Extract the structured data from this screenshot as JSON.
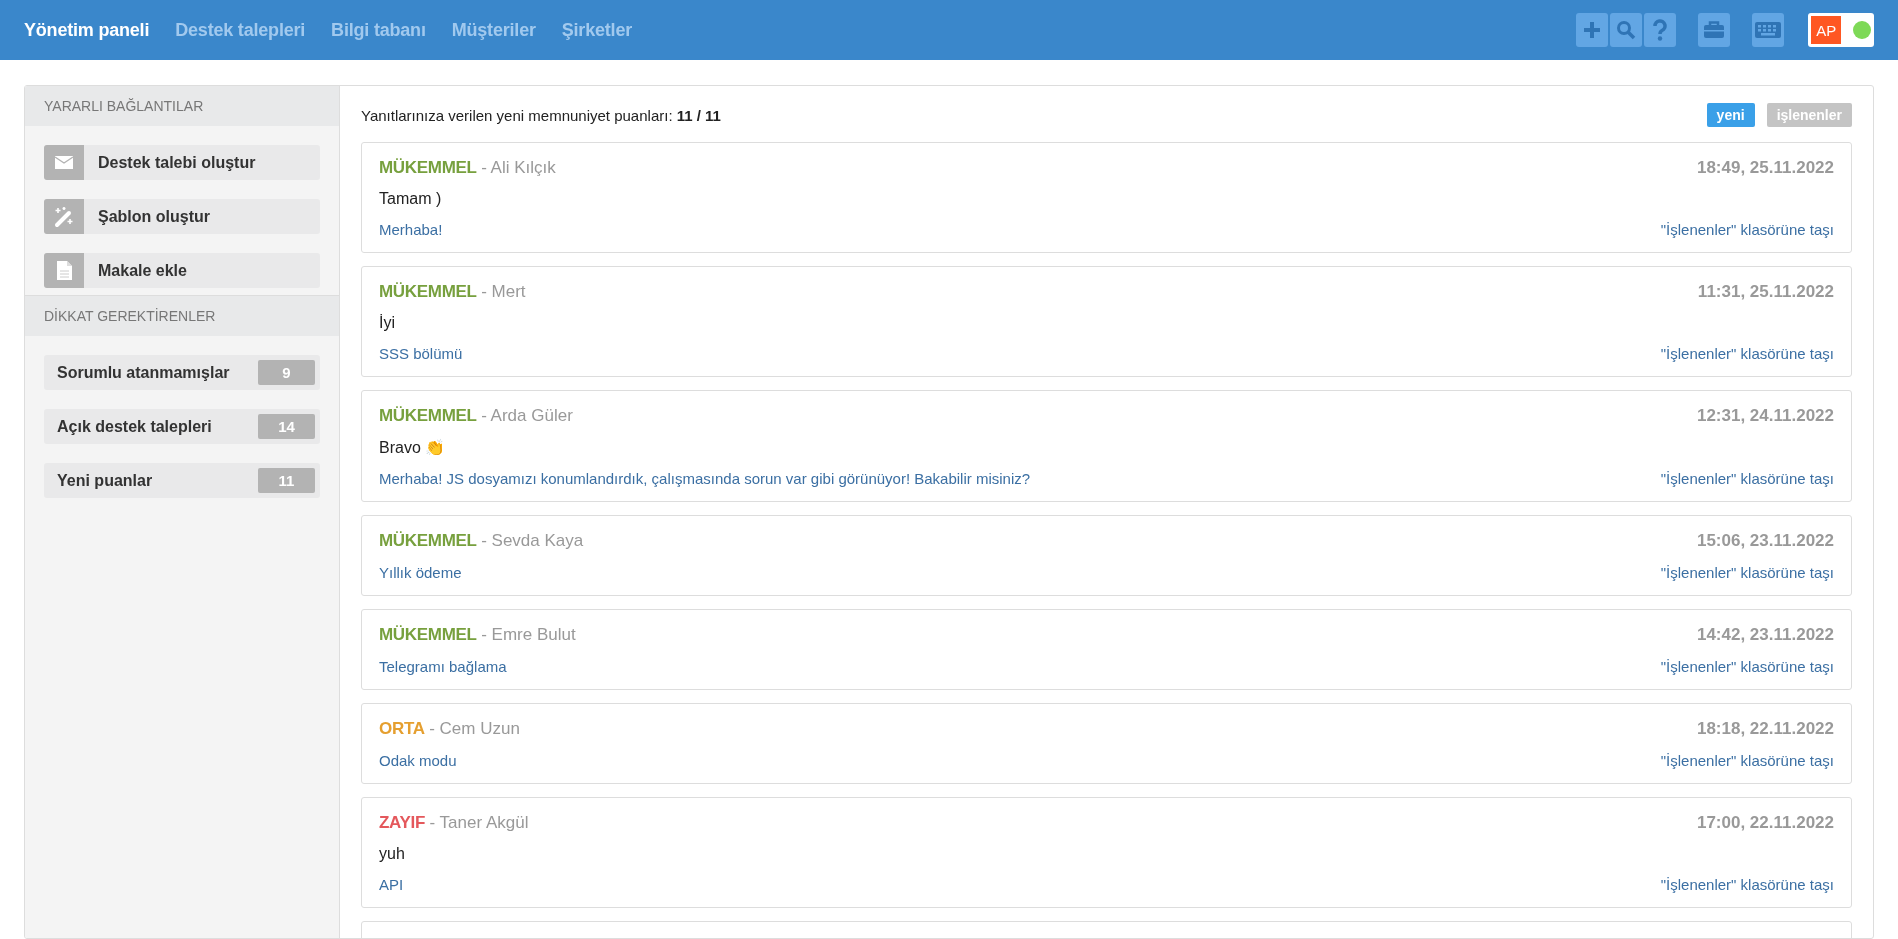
{
  "nav": [
    {
      "label": "Yönetim paneli",
      "selected": true
    },
    {
      "label": "Destek talepleri",
      "selected": false
    },
    {
      "label": "Bilgi tabanı",
      "selected": false
    },
    {
      "label": "Müşteriler",
      "selected": false
    },
    {
      "label": "Şirketler",
      "selected": false
    }
  ],
  "user": {
    "initials": "AP"
  },
  "sidebar": {
    "sections": [
      {
        "title": "YARARLI BAĞLANTILAR",
        "items": [
          {
            "kind": "link",
            "label": "Destek talebi oluştur"
          },
          {
            "kind": "link",
            "label": "Şablon oluştur"
          },
          {
            "kind": "link",
            "label": "Makale ekle"
          }
        ]
      },
      {
        "title": "DİKKAT GEREKTİRENLER",
        "items": [
          {
            "kind": "counter",
            "label": "Sorumlu atanmamışlar",
            "count": "9"
          },
          {
            "kind": "counter",
            "label": "Açık destek talepleri",
            "count": "14"
          },
          {
            "kind": "counter",
            "label": "Yeni puanlar",
            "count": "11"
          }
        ]
      }
    ]
  },
  "summary": "Yanıtlarınıza verilen yeni memnuniyet puanları: **11 / 11**",
  "filters": [
    {
      "label": "yeni",
      "selected": true
    },
    {
      "label": "işlenenler",
      "selected": false
    }
  ],
  "ratings": [
    {
      "kind": "excellent",
      "grade": "MÜKEMMEL",
      "author": "- Ali Kılçık",
      "time": "18:49, 25.11.2022",
      "comment": "Tamam )",
      "ticket": "Merhaba!",
      "action": "\"İşlenenler\" klasörüne taşı"
    },
    {
      "kind": "excellent",
      "grade": "MÜKEMMEL",
      "author": "- Mert",
      "time": "11:31, 25.11.2022",
      "comment": "İyi",
      "ticket": "SSS bölümü",
      "action": "\"İşlenenler\" klasörüne taşı"
    },
    {
      "kind": "excellent",
      "grade": "MÜKEMMEL",
      "author": "- Arda Güler",
      "time": "12:31, 24.11.2022",
      "comment": "Bravo 👏",
      "ticket": "Merhaba! JS dosyamızı konumlandırdık, çalışmasında sorun var gibi görünüyor! Bakabilir misiniz?",
      "action": "\"İşlenenler\" klasörüne taşı"
    },
    {
      "kind": "excellent",
      "grade": "MÜKEMMEL",
      "author": "- Sevda Kaya",
      "time": "15:06, 23.11.2022",
      "ticket": "Yıllık ödeme",
      "action": "\"İşlenenler\" klasörüne taşı"
    },
    {
      "kind": "excellent",
      "grade": "MÜKEMMEL",
      "author": "- Emre Bulut",
      "time": "14:42, 23.11.2022",
      "ticket": "Telegramı bağlama",
      "action": "\"İşlenenler\" klasörüne taşı"
    },
    {
      "kind": "medium",
      "grade": "ORTA",
      "author": "- Cem Uzun",
      "time": "18:18, 22.11.2022",
      "ticket": "Odak modu",
      "action": "\"İşlenenler\" klasörüne taşı"
    },
    {
      "kind": "poor",
      "grade": "ZAYIF",
      "author": "- Taner Akgül",
      "time": "17:00, 22.11.2022",
      "comment": "yuh",
      "ticket": "API",
      "action": "\"İşlenenler\" klasörüne taşı"
    }
  ]
}
